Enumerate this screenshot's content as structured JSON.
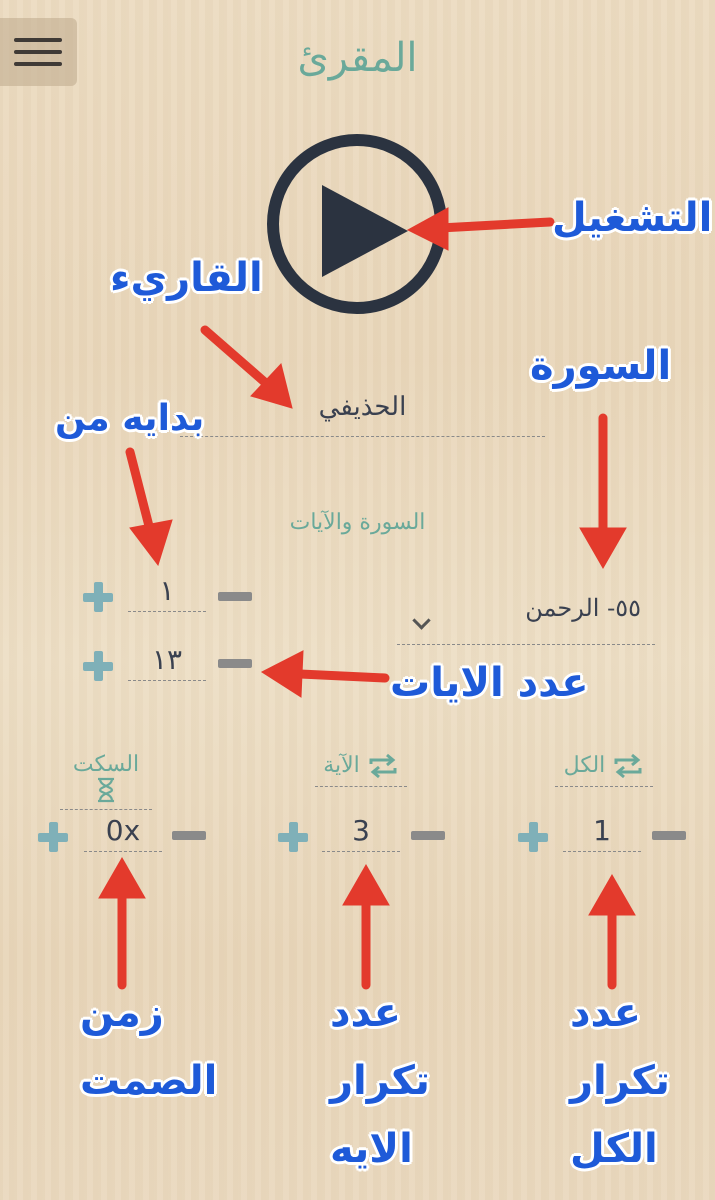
{
  "app": {
    "title": "المقرئ"
  },
  "menu": {
    "icon": "hamburger-icon"
  },
  "player": {
    "icon": "play-icon"
  },
  "reciter": {
    "name": "الحذيفي"
  },
  "surah_section": {
    "label": "السورة والآيات",
    "surah_value": "٥٥- الرحمن",
    "start_ayah": "١",
    "ayah_count": "١٣"
  },
  "repeat": {
    "silence": {
      "label": "السكت",
      "icon": "hourglass-icon",
      "value": "0x"
    },
    "ayah": {
      "label": "الآية",
      "icon": "repeat-icon",
      "value": "3"
    },
    "all": {
      "label": "الكل",
      "icon": "repeat-icon",
      "value": "1"
    }
  },
  "annotations": {
    "play": "التشغيل",
    "reciter": "القاريء",
    "surah": "السورة",
    "start_from": "بدايه من",
    "ayah_count": "عدد الايات",
    "silence_time": [
      "زمن",
      "الصمت"
    ],
    "ayah_repeat": [
      "عدد",
      "تكرار",
      "الايه"
    ],
    "all_repeat": [
      "عدد",
      "تكرار",
      "الكل"
    ]
  },
  "colors": {
    "accent": "#6aa99a",
    "dark": "#2b3340",
    "annotation_blue": "#1e5ad8",
    "arrow_red": "#e33a2c",
    "plus": "#7fb0b8",
    "minus": "#8a8a8a"
  }
}
